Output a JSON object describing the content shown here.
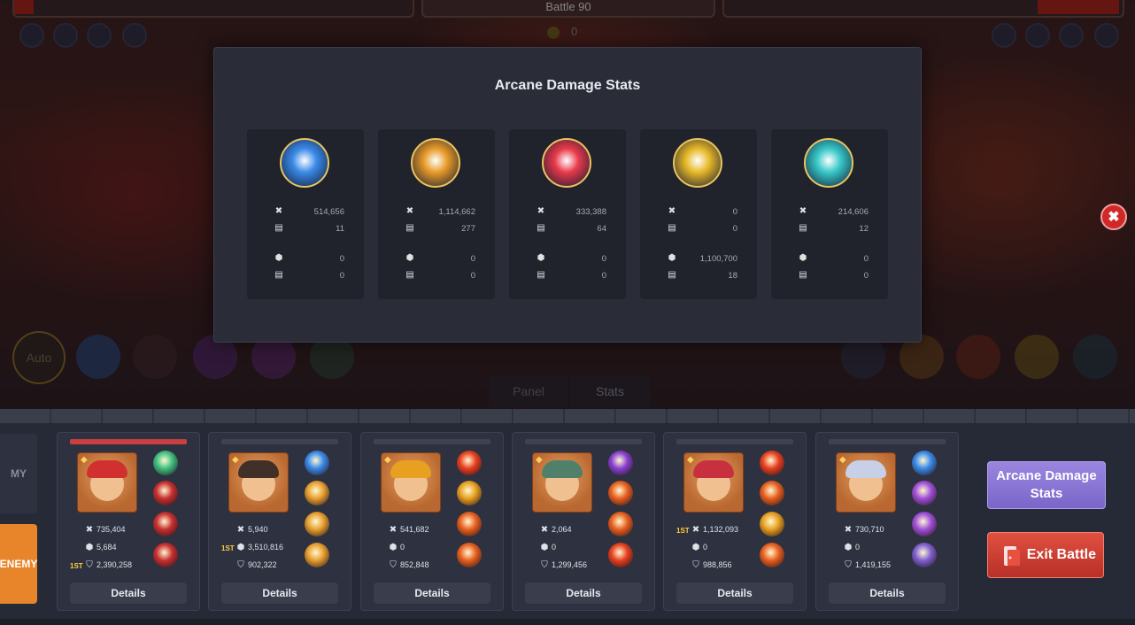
{
  "battle": {
    "title": "Battle 90",
    "coin_value": "0"
  },
  "scene": {
    "auto_label": "Auto",
    "tabs": [
      "Panel",
      "Stats"
    ]
  },
  "modal": {
    "title": "Arcane Damage Stats",
    "cards": [
      {
        "icon": "ice-arrows-icon",
        "color": "#3a8ae8",
        "damage": "514,656",
        "hits": "11",
        "shield": "0",
        "shield_hits": "0"
      },
      {
        "icon": "golden-star-icon",
        "color": "#e89a28",
        "damage": "1,114,662",
        "hits": "277",
        "shield": "0",
        "shield_hits": "0"
      },
      {
        "icon": "fire-slash-icon",
        "color": "#e83a4a",
        "damage": "333,388",
        "hits": "64",
        "shield": "0",
        "shield_hits": "0"
      },
      {
        "icon": "holy-figure-icon",
        "color": "#e8b828",
        "damage": "0",
        "hits": "0",
        "shield": "1,100,700",
        "shield_hits": "18"
      },
      {
        "icon": "frost-comet-icon",
        "color": "#38c8c8",
        "damage": "214,606",
        "hits": "12",
        "shield": "0",
        "shield_hits": "0"
      }
    ]
  },
  "side_tabs": {
    "my": "MY",
    "enemy": "ENEMY"
  },
  "heroes": [
    {
      "damage": "735,404",
      "healing": "5,684",
      "tank": "2,390,258",
      "first": "tank",
      "hat": "#d03030",
      "skills": [
        "#40c080",
        "#c83030",
        "#c83030",
        "#c83030"
      ],
      "details": "Details",
      "hp_red": true
    },
    {
      "damage": "5,940",
      "healing": "3,510,816",
      "tank": "902,322",
      "first": "healing",
      "hat": "#403028",
      "skills": [
        "#3a8ae8",
        "#e8a030",
        "#e8a030",
        "#e8a030"
      ],
      "details": "Details",
      "hp_red": false
    },
    {
      "damage": "541,682",
      "healing": "0",
      "tank": "852,848",
      "first": "",
      "hat": "#e8a020",
      "skills": [
        "#e84020",
        "#e8a020",
        "#e86020",
        "#e86020"
      ],
      "details": "Details",
      "hp_red": false
    },
    {
      "damage": "2,064",
      "healing": "0",
      "tank": "1,299,456",
      "first": "",
      "hat": "#50806a",
      "skills": [
        "#8a40d0",
        "#e86020",
        "#e86020",
        "#e84020"
      ],
      "details": "Details",
      "hp_red": false
    },
    {
      "damage": "1,132,093",
      "healing": "0",
      "tank": "988,856",
      "first": "damage",
      "hat": "#c83040",
      "skills": [
        "#e84020",
        "#e86020",
        "#e8a020",
        "#e86020"
      ],
      "details": "Details",
      "hp_red": false
    },
    {
      "damage": "730,710",
      "healing": "0",
      "tank": "1,419,155",
      "first": "",
      "hat": "#c8d0e8",
      "skills": [
        "#3a8ae8",
        "#a050d8",
        "#a050d8",
        "#8060d0"
      ],
      "details": "Details",
      "hp_red": false
    }
  ],
  "buttons": {
    "arcane_line1": "Arcane Damage",
    "arcane_line2": "Stats",
    "exit": "Exit Battle"
  },
  "first_badge": "1ST"
}
